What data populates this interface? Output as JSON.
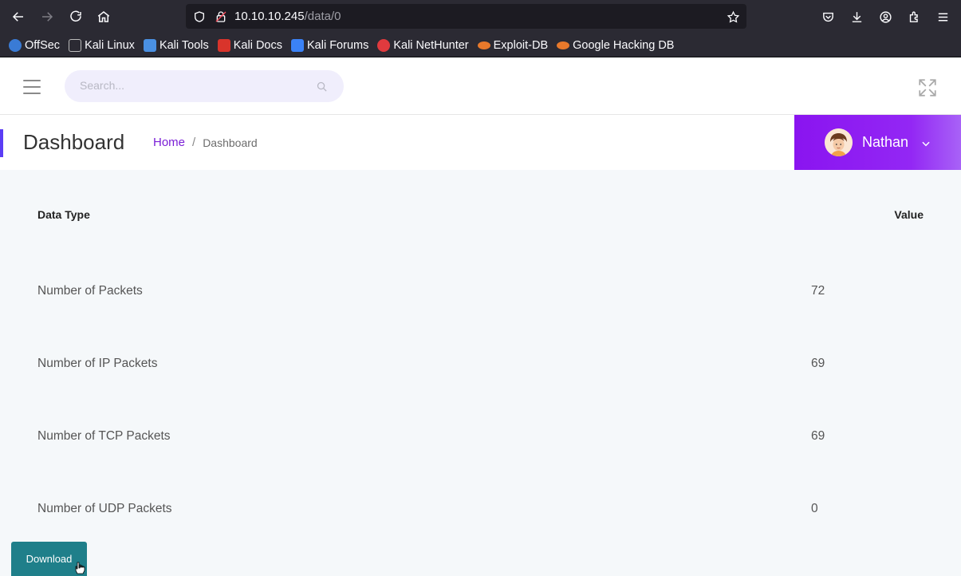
{
  "browser": {
    "url_host": "10.10.10.245",
    "url_path": "/data/0",
    "bookmarks": [
      {
        "label": "OffSec",
        "color": "#3a7bd5"
      },
      {
        "label": "Kali Linux",
        "color": "#2b2a33"
      },
      {
        "label": "Kali Tools",
        "color": "#4a90e2"
      },
      {
        "label": "Kali Docs",
        "color": "#d9342b"
      },
      {
        "label": "Kali Forums",
        "color": "#3b82f6"
      },
      {
        "label": "Kali NetHunter",
        "color": "#e03a3e"
      },
      {
        "label": "Exploit-DB",
        "color": "#e8792b"
      },
      {
        "label": "Google Hacking DB",
        "color": "#e8792b"
      }
    ]
  },
  "header": {
    "search_placeholder": "Search..."
  },
  "title_bar": {
    "title": "Dashboard",
    "breadcrumb_home": "Home",
    "breadcrumb_separator": "/",
    "breadcrumb_current": "Dashboard",
    "user_name": "Nathan"
  },
  "table": {
    "header_type": "Data Type",
    "header_value": "Value",
    "rows": [
      {
        "label": "Number of Packets",
        "value": "72"
      },
      {
        "label": "Number of IP Packets",
        "value": "69"
      },
      {
        "label": "Number of TCP Packets",
        "value": "69"
      },
      {
        "label": "Number of UDP Packets",
        "value": "0"
      }
    ]
  },
  "download_label": "Download",
  "colors": {
    "accent": "#7a1ed6",
    "user_panel": "#8a14f0",
    "download": "#1f7f8a"
  }
}
